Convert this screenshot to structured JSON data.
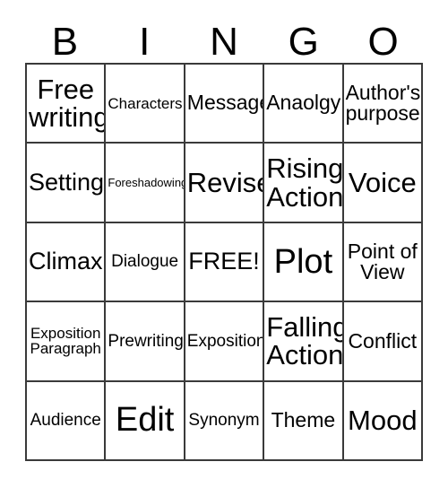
{
  "card": {
    "title": "BINGO",
    "header_letters": [
      "B",
      "I",
      "N",
      "G",
      "O"
    ],
    "border_color": "#3a3a3a",
    "text_color": "#000000",
    "background_color": "#ffffff",
    "columns": 5,
    "rows": 5,
    "cells": [
      {
        "text": "Free writing",
        "size": "xl"
      },
      {
        "text": "Characters",
        "size": "xs"
      },
      {
        "text": "Message",
        "size": "md"
      },
      {
        "text": "Anaolgy",
        "size": "md"
      },
      {
        "text": "Author's purpose",
        "size": "md"
      },
      {
        "text": "Setting",
        "size": "lg"
      },
      {
        "text": "Foreshadowing",
        "size": "xxs"
      },
      {
        "text": "Revise",
        "size": "xl"
      },
      {
        "text": "Rising Action",
        "size": "xl"
      },
      {
        "text": "Voice",
        "size": "xl"
      },
      {
        "text": "Climax",
        "size": "lg"
      },
      {
        "text": "Dialogue",
        "size": "sm"
      },
      {
        "text": "FREE!",
        "size": "lg"
      },
      {
        "text": "Plot",
        "size": "xxl"
      },
      {
        "text": "Point of View",
        "size": "md"
      },
      {
        "text": "Exposition Paragraph",
        "size": "xs"
      },
      {
        "text": "Prewriting",
        "size": "sm"
      },
      {
        "text": "Exposition",
        "size": "sm"
      },
      {
        "text": "Falling Action",
        "size": "xl"
      },
      {
        "text": "Conflict",
        "size": "md"
      },
      {
        "text": "Audience",
        "size": "sm"
      },
      {
        "text": "Edit",
        "size": "xxl"
      },
      {
        "text": "Synonym",
        "size": "sm"
      },
      {
        "text": "Theme",
        "size": "md"
      },
      {
        "text": "Mood",
        "size": "xl"
      }
    ]
  }
}
